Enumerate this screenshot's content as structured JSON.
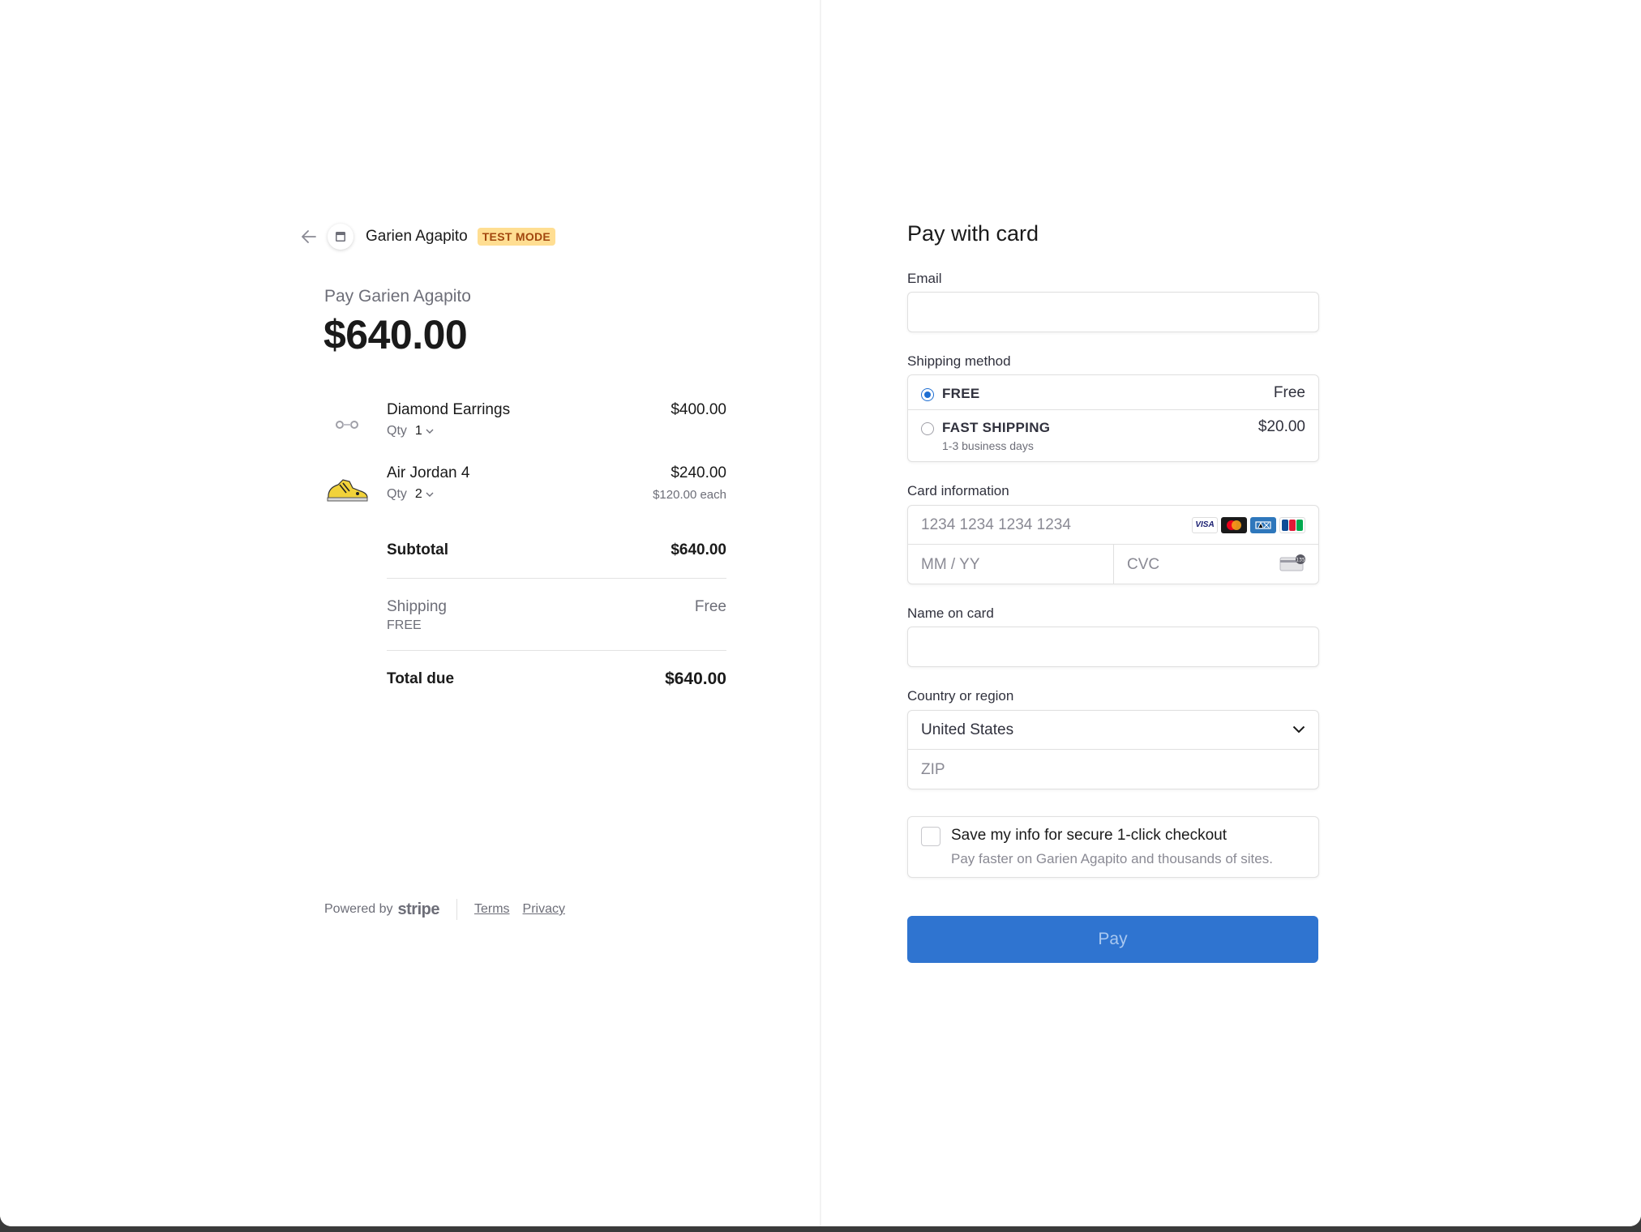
{
  "header": {
    "merchant_name": "Garien Agapito",
    "test_badge": "TEST MODE",
    "back_icon": "arrow-left-icon",
    "logo_icon": "store-icon"
  },
  "summary": {
    "pay_to": "Pay Garien Agapito",
    "total": "$640.00",
    "items": [
      {
        "name": "Diamond Earrings",
        "qty_label": "Qty",
        "qty": "1",
        "price": "$400.00",
        "each": "",
        "thumb_icon": "earrings-icon"
      },
      {
        "name": "Air Jordan 4",
        "qty_label": "Qty",
        "qty": "2",
        "price": "$240.00",
        "each": "$120.00 each",
        "thumb_icon": "sneaker-icon"
      }
    ],
    "subtotal_label": "Subtotal",
    "subtotal_value": "$640.00",
    "shipping_label": "Shipping",
    "shipping_method": "FREE",
    "shipping_value": "Free",
    "total_due_label": "Total due",
    "total_due_value": "$640.00"
  },
  "footer": {
    "powered_by": "Powered by",
    "stripe": "stripe",
    "terms": "Terms",
    "privacy": "Privacy"
  },
  "form": {
    "title": "Pay with card",
    "email_label": "Email",
    "email_value": "",
    "shipping_label": "Shipping method",
    "shipping_options": [
      {
        "name": "FREE",
        "days": "",
        "price": "Free",
        "selected": true
      },
      {
        "name": "FAST SHIPPING",
        "days": "1-3 business days",
        "price": "$20.00",
        "selected": false
      }
    ],
    "card_label": "Card information",
    "card_number_placeholder": "1234 1234 1234 1234",
    "expiry_placeholder": "MM / YY",
    "cvc_placeholder": "CVC",
    "card_brands": [
      "VISA",
      "mastercard",
      "amex",
      "JCB"
    ],
    "name_label": "Name on card",
    "name_value": "",
    "country_label": "Country or region",
    "country_value": "United States",
    "zip_placeholder": "ZIP",
    "save_title": "Save my info for secure 1-click checkout",
    "save_sub": "Pay faster on Garien Agapito and thousands of sites.",
    "pay_button": "Pay"
  },
  "colors": {
    "accent": "#2f74d0",
    "badge_bg": "#ffde92",
    "badge_text": "#a2470e",
    "muted_text": "#6d6e78"
  }
}
